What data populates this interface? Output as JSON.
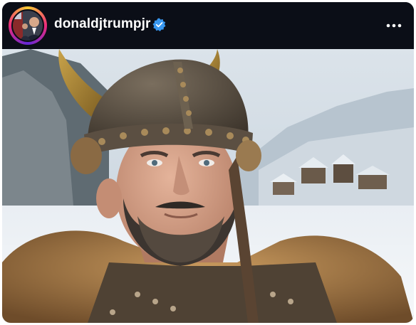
{
  "post": {
    "username": "donaldjtrumpjr",
    "verified": true,
    "avatar_icon": "profile-photo",
    "more_icon": "more-options-icon",
    "photo_description_icon": "viking-portrait-photo"
  },
  "colors": {
    "header_bg": "#0b0e17",
    "verified_badge": "#3897f0",
    "text": "#ffffff"
  }
}
